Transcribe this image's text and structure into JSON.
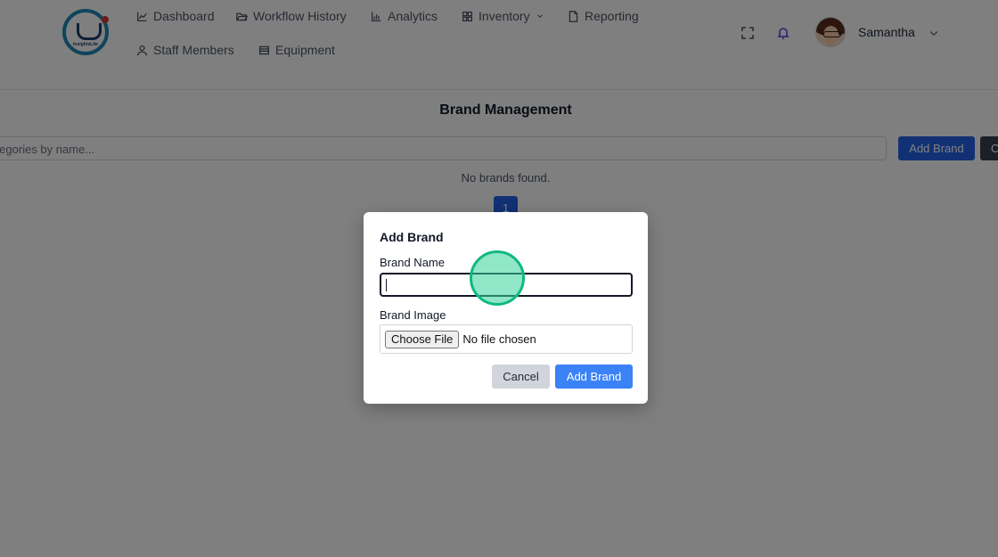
{
  "nav": {
    "logo_text": "InsightsLite",
    "items": [
      {
        "label": "Dashboard",
        "icon": "chart-line-icon"
      },
      {
        "label": "Workflow History",
        "icon": "folder-open-icon"
      },
      {
        "label": "Analytics",
        "icon": "bar-chart-icon"
      },
      {
        "label": "Inventory",
        "icon": "grid-icon"
      },
      {
        "label": "Reporting",
        "icon": "document-icon"
      },
      {
        "label": "Staff Members",
        "icon": "user-icon"
      },
      {
        "label": "Equipment",
        "icon": "list-icon"
      }
    ],
    "user": {
      "name": "Samantha"
    }
  },
  "page": {
    "title": "Brand Management",
    "search_placeholder": "h categories by name...",
    "add_button": "Add Brand",
    "clear_button": "C",
    "empty_message": "No brands found.",
    "current_page": "1"
  },
  "modal": {
    "title": "Add Brand",
    "name_label": "Brand Name",
    "name_value": "",
    "image_label": "Brand Image",
    "choose_file": "Choose File",
    "no_file": "No file chosen",
    "cancel": "Cancel",
    "submit": "Add Brand"
  },
  "colors": {
    "primary": "#2563eb",
    "submit": "#3b82f6",
    "cancel_bg": "#d1d5db",
    "click_marker": "#10b981"
  }
}
